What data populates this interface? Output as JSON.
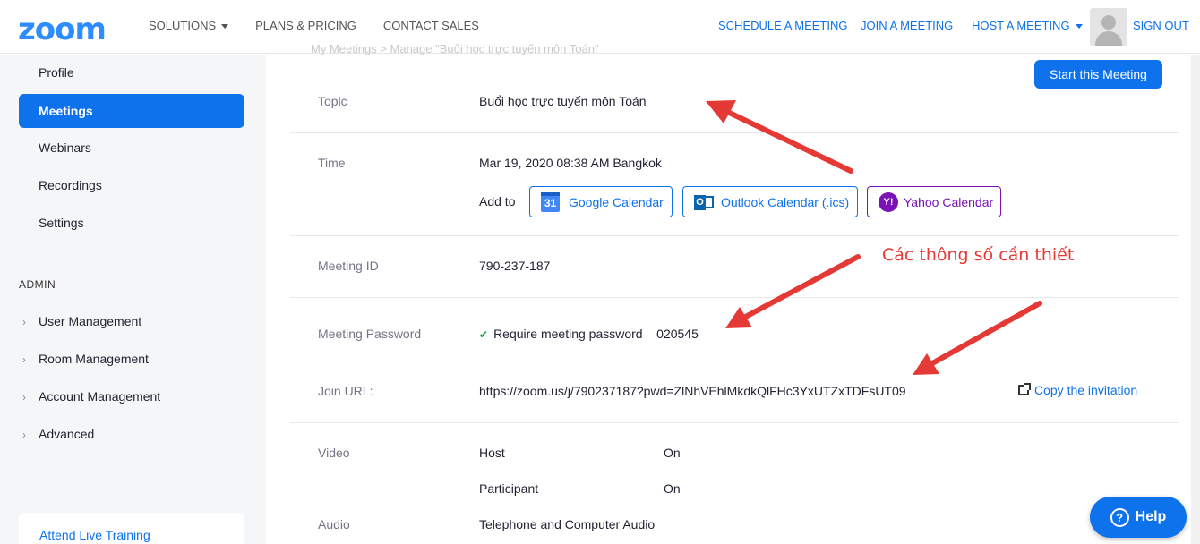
{
  "header": {
    "logo": "zoom",
    "nav_left": [
      "SOLUTIONS",
      "PLANS & PRICING",
      "CONTACT SALES"
    ],
    "schedule": "SCHEDULE A MEETING",
    "join": "JOIN A MEETING",
    "host": "HOST A MEETING",
    "signout": "SIGN OUT"
  },
  "sidebar": {
    "items": [
      "Profile",
      "Meetings",
      "Webinars",
      "Recordings",
      "Settings"
    ],
    "active": "Meetings",
    "admin_title": "ADMIN",
    "admin_items": [
      "User Management",
      "Room Management",
      "Account Management",
      "Advanced"
    ],
    "training_link": "Attend Live Training"
  },
  "main": {
    "breadcrumb": "My Meetings  >  Manage \"Buổi học trực tuyến môn Toán\"",
    "start_button": "Start this Meeting",
    "topic_label": "Topic",
    "topic_value": "Buổi học trực tuyến môn Toán",
    "time_label": "Time",
    "time_value": "Mar 19, 2020 08:38 AM Bangkok",
    "add_to": "Add to",
    "google_calendar": "Google Calendar",
    "google_calendar_day": "31",
    "outlook_calendar": "Outlook Calendar (.ics)",
    "yahoo_calendar": "Yahoo Calendar",
    "meeting_id_label": "Meeting ID",
    "meeting_id_value": "790-237-187",
    "password_label": "Meeting Password",
    "password_require": "Require meeting password",
    "password_value": "020545",
    "join_url_label": "Join URL:",
    "join_url_value": "https://zoom.us/j/790237187?pwd=ZlNhVEhlMkdkQlFHc3YxUTZxTDFsUT09",
    "copy_invitation": "Copy the invitation",
    "video_label": "Video",
    "host_label": "Host",
    "host_value": "On",
    "participant_label": "Participant",
    "participant_value": "On",
    "audio_label": "Audio",
    "audio_value": "Telephone and Computer Audio"
  },
  "annotation": {
    "text": "Các thông số cần thiết",
    "color": "#e53935"
  },
  "help": {
    "label": "Help"
  },
  "colors": {
    "brand": "#2D8CFF",
    "primary": "#0E72ED",
    "yahoo": "#7b12b5"
  }
}
